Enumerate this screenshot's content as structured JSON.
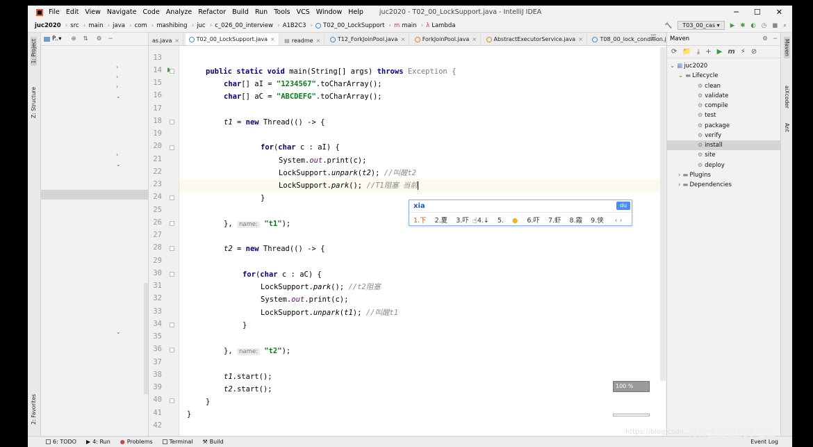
{
  "menu": {
    "items": [
      "File",
      "Edit",
      "View",
      "Navigate",
      "Code",
      "Analyze",
      "Refactor",
      "Build",
      "Run",
      "Tools",
      "VCS",
      "Window",
      "Help"
    ],
    "window_title": "juc2020 - T02_00_LockSupport.java - IntelliJ IDEA"
  },
  "nav": {
    "breadcrumbs": [
      "juc2020",
      "src",
      "main",
      "java",
      "com",
      "mashibing",
      "juc",
      "c_026_00_interview",
      "A1B2C3",
      "T02_00_LockSupport",
      "main",
      "Lambda"
    ],
    "run_config": "T03_00_cas"
  },
  "project_panel": {
    "title": "P..▾",
    "stripe_project": "1: Project",
    "stripe_structure": "Z: Structure",
    "stripe_favorites": "2: Favorites"
  },
  "tabs": [
    "as.java",
    "T02_00_LockSupport.java",
    "readme",
    "T12_ForkJoinPool.java",
    "ForkJoinPool.java",
    "AbstractExecutorService.java",
    "T08_00_lock_condition.java"
  ],
  "active_tab": "T02_00_LockSupport.java",
  "code": {
    "line_numbers": [
      "13",
      "14",
      "15",
      "16",
      "17",
      "18",
      "19",
      "20",
      "21",
      "22",
      "23",
      "24",
      "25",
      "26",
      "27",
      "28",
      "29",
      "30",
      "31",
      "32",
      "33",
      "34",
      "35",
      "36",
      "37",
      "38",
      "39",
      "40",
      "41",
      "42"
    ],
    "l14_public": "public",
    "l14_static": "static",
    "l14_void": "void",
    "l14_main": " main(String[] args) ",
    "l14_throws": "throws",
    "l14_exc": " Exception {",
    "l15_char": "char",
    "l15_a": "[] aI = ",
    "l15_str": "\"1234567\"",
    "l15_b": ".toCharArray();",
    "l16_char": "char",
    "l16_a": "[] aC = ",
    "l16_str": "\"ABCDEFG\"",
    "l16_b": ".toCharArray();",
    "l18_t1": "t1",
    "l18_a": " = ",
    "l18_new": "new",
    "l18_b": " Thread(() -> {",
    "l20_for": "for",
    "l20_a": "(",
    "l20_char": "char",
    "l20_b": " c : aI) {",
    "l21_a": "System.",
    "l21_out": "out",
    "l21_b": ".print(c);",
    "l22_a": "LockSupport.",
    "l22_m": "unpark",
    "l22_b": "(",
    "l22_t": "t2",
    "l22_c": "); ",
    "l22_cmt": "//叫醒t2",
    "l23_a": "LockSupport.",
    "l23_m": "park",
    "l23_b": "(); ",
    "l23_cmt": "//T1阻塞 当前",
    "l24": "}",
    "l26_a": "}, ",
    "l26_hint": "name:",
    "l26_str": "\"t1\"",
    "l26_b": ");",
    "l28_t2": "t2",
    "l28_a": " = ",
    "l28_new": "new",
    "l28_b": " Thread(() -> {",
    "l30_for": "for",
    "l30_a": "(",
    "l30_char": "char",
    "l30_b": " c : aC) {",
    "l31_a": "LockSupport.",
    "l31_m": "park",
    "l31_b": "(); ",
    "l31_cmt": "//t2阻塞",
    "l32_a": "System.",
    "l32_out": "out",
    "l32_b": ".print(c);",
    "l33_a": "LockSupport.",
    "l33_m": "unpark",
    "l33_b": "(",
    "l33_t": "t1",
    "l33_c": "); ",
    "l33_cmt": "//叫醒t1",
    "l34": "}",
    "l36_a": "}, ",
    "l36_hint": "name:",
    "l36_str": "\"t2\"",
    "l36_b": ");",
    "l38_t": "t1",
    "l38_b": ".start();",
    "l39_t": "t2",
    "l39_b": ".start();",
    "l40": "}",
    "l41": "}"
  },
  "ime": {
    "composition": "xia",
    "logo": "du",
    "candidates": [
      "1.下",
      "2.夏",
      "3.吓",
      "4.↓",
      "5.",
      "6.吓",
      "7.虾",
      "8.霞",
      "9.侠"
    ],
    "nav": "‹ ›"
  },
  "maven": {
    "title": "Maven",
    "project": "juc2020",
    "lifecycle_label": "Lifecycle",
    "goals": [
      "clean",
      "validate",
      "compile",
      "test",
      "package",
      "verify",
      "install",
      "site",
      "deploy"
    ],
    "selected_goal": "install",
    "plugins_label": "Plugins",
    "dependencies_label": "Dependencies",
    "stripe_maven": "Maven",
    "stripe_aicoder": "aiXcoder",
    "stripe_ant": "Ant"
  },
  "progress_text": "100 %",
  "bottom": {
    "items": [
      "6: TODO",
      "4: Run",
      "Problems",
      "Terminal",
      "Build"
    ],
    "event_log": "Event Log"
  },
  "watermark": {
    "url": "https://blog.csdn...",
    "brand": "@稀土掘金技术社区"
  }
}
